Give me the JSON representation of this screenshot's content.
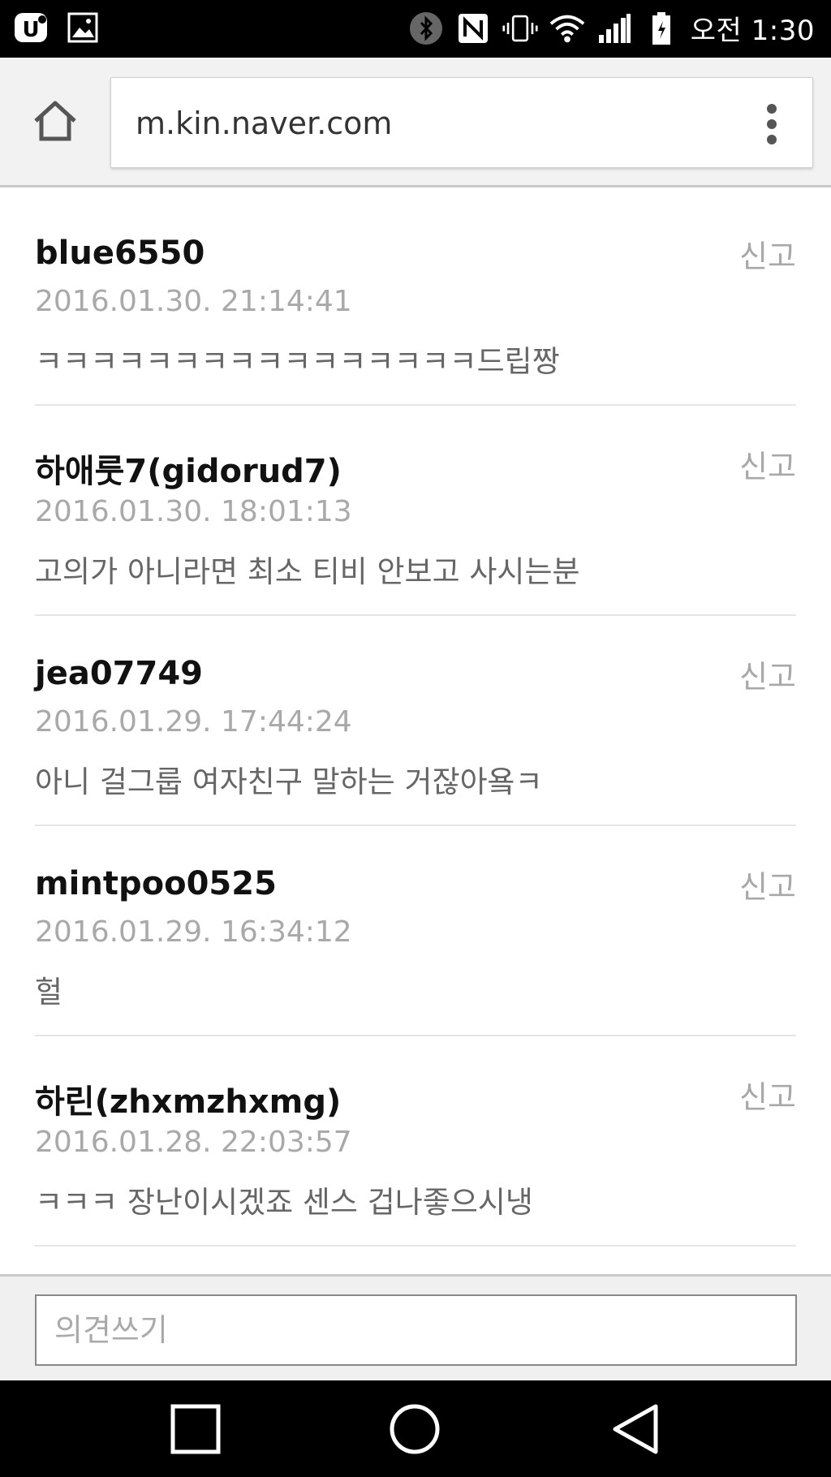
{
  "status_bar": {
    "time": "오전 1:30",
    "icons_left": [
      "u-plus-icon",
      "gallery-icon"
    ],
    "icons_right": [
      "bluetooth-icon",
      "nfc-icon",
      "vibrate-icon",
      "wifi-icon",
      "signal-icon",
      "battery-icon"
    ]
  },
  "browser": {
    "url": "m.kin.naver.com",
    "home_icon": "home-icon",
    "menu_icon": "more-vert-icon"
  },
  "comments": [
    {
      "user": "blue6550",
      "date": "2016.01.30. 21:14:41",
      "text": "ㅋㅋㅋㅋㅋㅋㅋㅋㅋㅋㅋㅋㅋㅋㅋㅋ드립짱",
      "report": "신고"
    },
    {
      "user": "하애룻7(gidorud7)",
      "date": "2016.01.30. 18:01:13",
      "text": "고의가 아니라면 최소 티비 안보고 사시는분",
      "report": "신고"
    },
    {
      "user": "jea07749",
      "date": "2016.01.29. 17:44:24",
      "text": "아니 걸그룹 여자친구 말하는 거잖아욬ㅋ",
      "report": "신고"
    },
    {
      "user": "mintpoo0525",
      "date": "2016.01.29. 16:34:12",
      "text": "헐",
      "report": "신고"
    },
    {
      "user": "하린(zhxmzhxmg)",
      "date": "2016.01.28. 22:03:57",
      "text": "ㅋㅋㅋ 장난이시겠죠 센스 겁나좋으시냉",
      "report": "신고"
    }
  ],
  "write": {
    "placeholder": "의견쓰기",
    "value": ""
  },
  "nav": {
    "recent_icon": "recent-apps-icon",
    "home_icon": "home-circle-icon",
    "back_icon": "back-triangle-icon"
  }
}
